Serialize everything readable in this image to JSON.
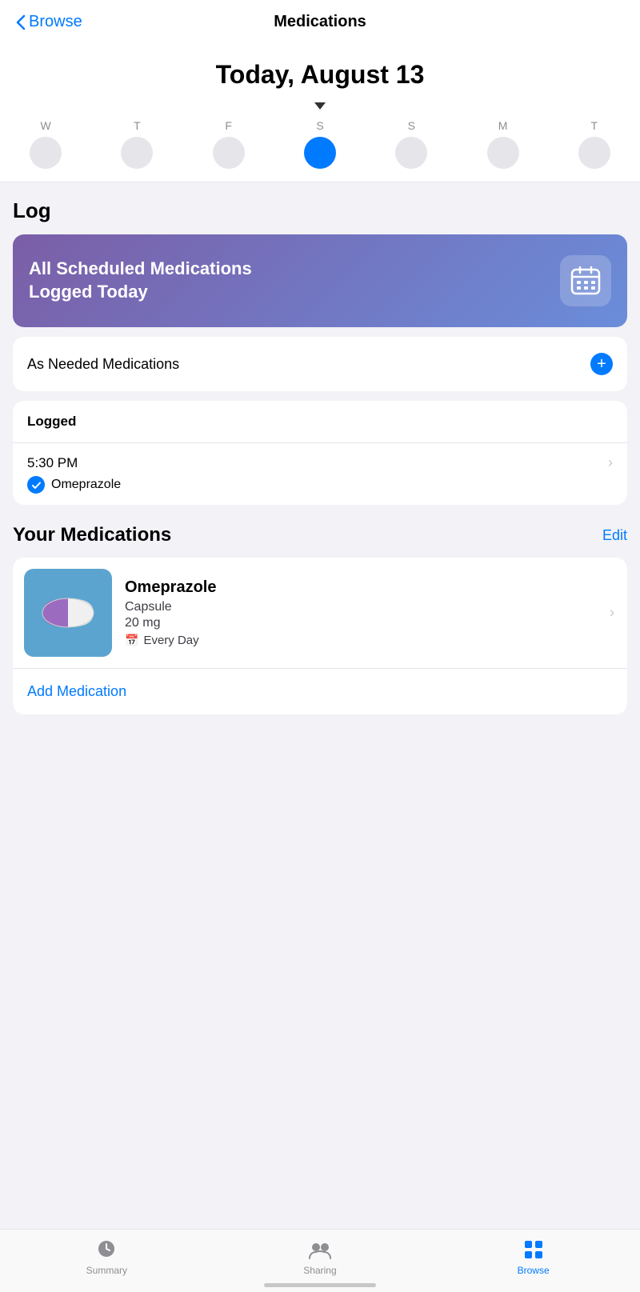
{
  "nav": {
    "back_label": "Browse",
    "title": "Medications"
  },
  "date": {
    "label": "Today, August 13"
  },
  "week": {
    "days": [
      {
        "letter": "W",
        "num": ""
      },
      {
        "letter": "T",
        "num": ""
      },
      {
        "letter": "F",
        "num": ""
      },
      {
        "letter": "S",
        "num": "",
        "today": true
      },
      {
        "letter": "S",
        "num": ""
      },
      {
        "letter": "M",
        "num": ""
      },
      {
        "letter": "T",
        "num": ""
      }
    ]
  },
  "log": {
    "section_title": "Log",
    "scheduled_card": {
      "text_line1": "All Scheduled Medications",
      "text_line2": "Logged Today"
    },
    "as_needed": {
      "label": "As Needed Medications",
      "plus": "+"
    },
    "logged": {
      "header": "Logged",
      "items": [
        {
          "time": "5:30 PM",
          "medication": "Omeprazole"
        }
      ]
    }
  },
  "your_medications": {
    "title": "Your Medications",
    "edit_label": "Edit",
    "medications": [
      {
        "name": "Omeprazole",
        "type": "Capsule",
        "dose": "20 mg",
        "schedule": "Every Day"
      }
    ],
    "add_label": "Add Medication"
  },
  "tab_bar": {
    "tabs": [
      {
        "label": "Summary",
        "active": false
      },
      {
        "label": "Sharing",
        "active": false
      },
      {
        "label": "Browse",
        "active": true
      }
    ]
  }
}
